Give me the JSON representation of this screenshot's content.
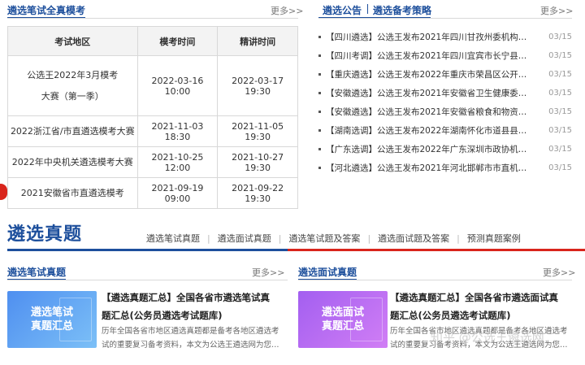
{
  "exam_section": {
    "title": "遴选笔试全真模考",
    "more": "更多>>"
  },
  "exam_table": {
    "headers": [
      "考试地区",
      "模考时间",
      "精讲时间"
    ],
    "rows": [
      {
        "name": "公选王2022年3月模考大赛（第一季）",
        "t1": "2022-03-16 10:00",
        "t2": "2022-03-17 19:30"
      },
      {
        "name": "2022浙江省/市直遴选模考大赛",
        "t1": "2021-11-03 18:30",
        "t2": "2021-11-05 19:30"
      },
      {
        "name": "2022年中央机关遴选模考大赛",
        "t1": "2021-10-25 12:00",
        "t2": "2021-10-27 19:30"
      },
      {
        "name": "2021安徽省市直遴选模考",
        "t1": "2021-09-19 09:00",
        "t2": "2021-09-22 19:30"
      }
    ]
  },
  "news_section": {
    "tab_active": "遴选公告",
    "tab_other": "遴选备考策略",
    "more": "更多>>"
  },
  "news": [
    {
      "text": "【四川遴选】公选王发布2021年四川甘孜州委机构…",
      "date": "03/15"
    },
    {
      "text": "【四川考调】公选王发布2021年四川宜宾市长宁县…",
      "date": "03/15"
    },
    {
      "text": "【重庆遴选】公选王发布2022年重庆市荣昌区公开…",
      "date": "03/15"
    },
    {
      "text": "【安徽遴选】公选王发布2021年安徽省卫生健康委…",
      "date": "03/15"
    },
    {
      "text": "【安徽遴选】公选王发布2021年安徽省粮食和物资…",
      "date": "03/15"
    },
    {
      "text": "【湖南选调】公选王发布2022年湖南怀化市道县县…",
      "date": "03/15"
    },
    {
      "text": "【广东选调】公选王发布2022年广东深圳市政协机…",
      "date": "03/15"
    },
    {
      "text": "【河北遴选】公选王发布2021年河北邯郸市市直机…",
      "date": "03/15"
    }
  ],
  "banner": {
    "title": "遴选真题",
    "links": [
      "遴选笔试真题",
      "遴选面试真题",
      "遴选笔试题及答案",
      "遴选面试题及答案",
      "预测真题案例"
    ],
    "sep": "|"
  },
  "written_section": {
    "title": "遴选笔试真题",
    "more": "更多>>",
    "thumb_text": "遴选笔试\n真题汇总",
    "card_title_1": "【遴选真题汇总】全国各省市遴选笔试真",
    "card_title_2": "题汇总(公务员遴选考试题库)",
    "desc_1": "历年全国各省市地区遴选真题都是备考各地区遴选考",
    "desc_2": "试的重要复习备考资料，本文为公选王遴选网为您…"
  },
  "interview_section": {
    "title": "遴选面试真题",
    "more": "更多>>",
    "thumb_text": "遴选面试\n真题汇总",
    "card_title_1": "【遴选真题汇总】全国各省市遴选面试真",
    "card_title_2": "题汇总(公务员遴选考试题库)",
    "desc_1": "历年全国各省市地区遴选真题都是备考各地区遴选考",
    "desc_2": "试的重要复习备考资料，本文为公选王遴选网为您…"
  },
  "watermark": "知乎 @公选王遴选网",
  "colors": {
    "accent_blue": "#1d4f9c",
    "red": "#d9251c",
    "thumb_blue": "#5aa0f0",
    "thumb_purple": "#b76cf0"
  }
}
